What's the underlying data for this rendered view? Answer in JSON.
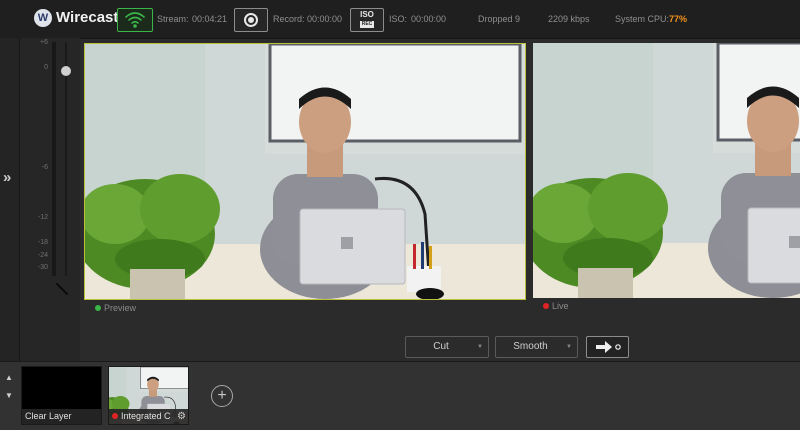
{
  "app": {
    "title": "Wirecast",
    "logo_letter": "W"
  },
  "toolbar": {
    "stream_label": "Stream:",
    "stream_time": "00:04:21",
    "record_label": "Record:",
    "record_time": "00:00:00",
    "iso_button_label": "ISO",
    "iso_button_sublabel": "REC",
    "iso_label": "ISO:",
    "iso_time": "00:00:00",
    "dropped": "Dropped 9",
    "bitrate": "2209 kbps",
    "cpu_label": "System CPU:",
    "cpu_value": "77%",
    "cpu_color": "#f7941d",
    "stream_active_color": "#39b54a"
  },
  "audio_meter": {
    "labels": [
      "+6",
      "0",
      "-6",
      "-12",
      "-18",
      "-24",
      "-30"
    ]
  },
  "monitors": {
    "preview_label": "Preview",
    "preview_dot_color": "#39b54a",
    "live_label": "Live",
    "live_dot_color": "#e02424"
  },
  "transitions": {
    "cut_label": "Cut",
    "smooth_label": "Smooth",
    "go_icon": "arrow-right-icon"
  },
  "shots": [
    {
      "label": "Clear Layer"
    },
    {
      "label": "Integrated C"
    }
  ],
  "icons": [
    "wifi-stream-icon",
    "record-icon",
    "iso-rec-icon",
    "collapse-chevron-icon",
    "gear-icon",
    "add-shot-icon",
    "arrow-up-icon",
    "arrow-down-icon"
  ]
}
